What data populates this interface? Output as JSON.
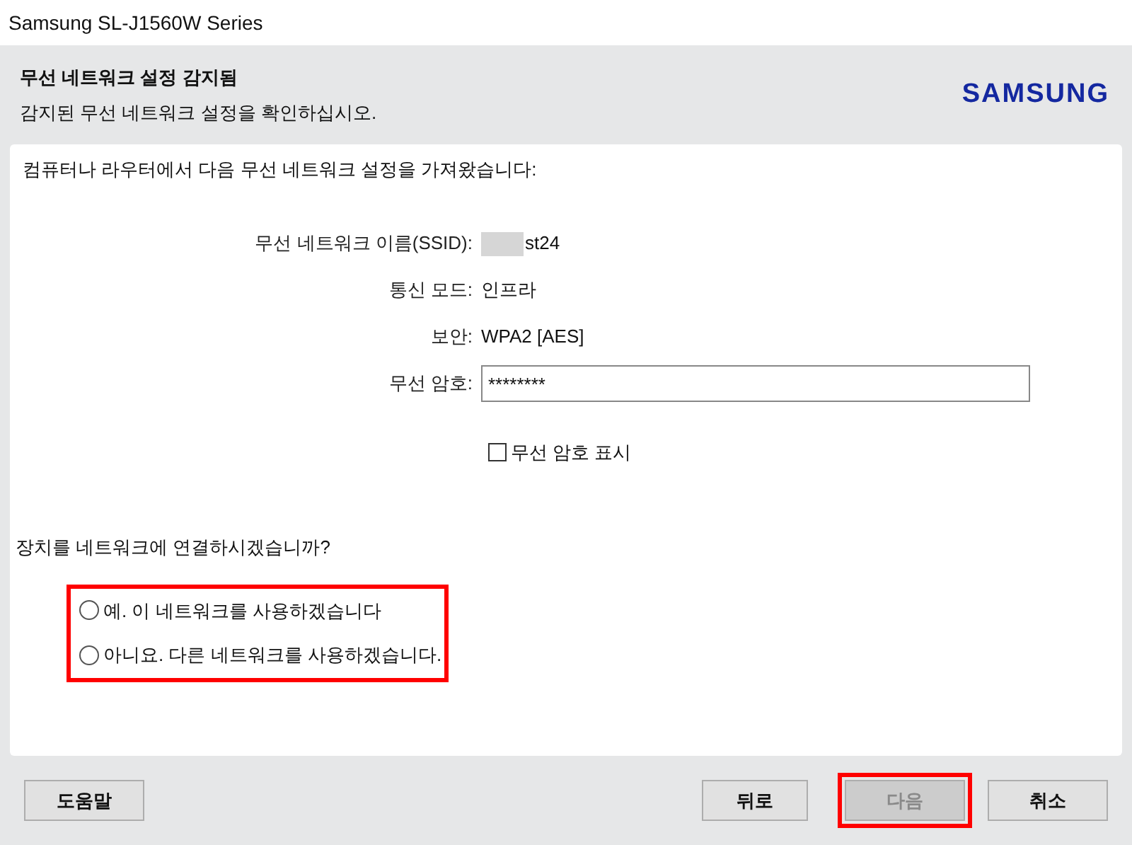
{
  "window": {
    "title": "Samsung SL-J1560W Series"
  },
  "header": {
    "title": "무선 네트워크 설정 감지됨",
    "subtitle": "감지된 무선 네트워크 설정을 확인하십시오.",
    "logo": "SAMSUNG"
  },
  "intro": "컴퓨터나 라우터에서 다음 무선 네트워크 설정을 가져왔습니다:",
  "fields": [
    {
      "kind": "text",
      "label": "무선 네트워크 이름(SSID):",
      "value": "st24",
      "redacted": true
    },
    {
      "kind": "text",
      "label": "통신 모드:",
      "value": "인프라",
      "redacted": false
    },
    {
      "kind": "text",
      "label": "보안:",
      "value": "WPA2 [AES]",
      "redacted": false
    },
    {
      "kind": "input",
      "label": "무선 암호:",
      "value": "********"
    }
  ],
  "show_password": {
    "label": "무선 암호 표시",
    "checked": false
  },
  "question": "장치를 네트워크에 연결하시겠습니까?",
  "options": [
    {
      "label": "예. 이 네트워크를 사용하겠습니다",
      "selected": false
    },
    {
      "label": "아니요. 다른 네트워크를 사용하겠습니다.",
      "selected": false
    }
  ],
  "options_highlighted": true,
  "buttons": [
    {
      "kind": "help",
      "label": "도움말",
      "disabled": false,
      "highlighted": false
    },
    {
      "kind": "back",
      "label": "뒤로",
      "disabled": false,
      "highlighted": false
    },
    {
      "kind": "next",
      "label": "다음",
      "disabled": true,
      "highlighted": true
    },
    {
      "kind": "cancel",
      "label": "취소",
      "disabled": false,
      "highlighted": false
    }
  ]
}
